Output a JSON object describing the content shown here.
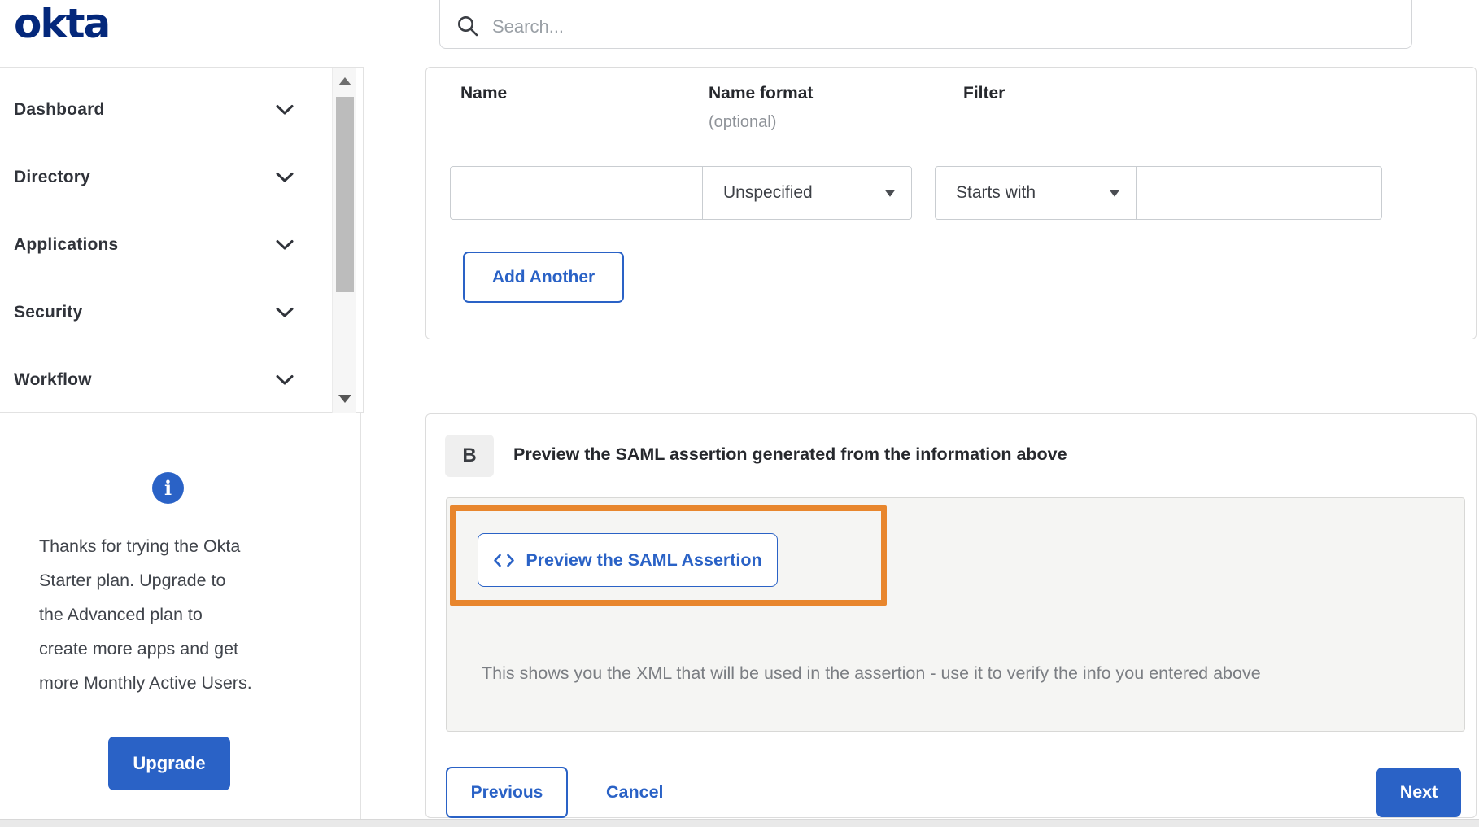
{
  "brand": {
    "logo_text": "okta"
  },
  "search": {
    "placeholder": "Search..."
  },
  "sidebar": {
    "items": [
      {
        "label": "Dashboard"
      },
      {
        "label": "Directory"
      },
      {
        "label": "Applications"
      },
      {
        "label": "Security"
      },
      {
        "label": "Workflow"
      }
    ],
    "upsell": {
      "text": "Thanks for trying the Okta\nStarter plan. Upgrade to\nthe Advanced plan to\ncreate more apps and get\nmore Monthly Active Users.",
      "upgrade_label": "Upgrade"
    }
  },
  "attribute_form": {
    "columns": {
      "name_label": "Name",
      "name_format_label": "Name format",
      "name_format_hint": "(optional)",
      "filter_label": "Filter"
    },
    "name_value": "",
    "name_format_value": "Unspecified",
    "filter_type_value": "Starts with",
    "filter_value": "",
    "add_another_label": "Add Another"
  },
  "preview_section": {
    "badge": "B",
    "title": "Preview the SAML assertion generated from the information above",
    "preview_button_label": "Preview the SAML Assertion",
    "note": "This shows you the XML that will be used in the assertion - use it to verify the info you entered above"
  },
  "footer": {
    "previous_label": "Previous",
    "cancel_label": "Cancel",
    "next_label": "Next"
  },
  "icons": {
    "info_glyph": "i"
  },
  "colors": {
    "accent_blue": "#2a62c6",
    "logo_navy": "#04287b",
    "annotation_orange": "#e8862d"
  }
}
